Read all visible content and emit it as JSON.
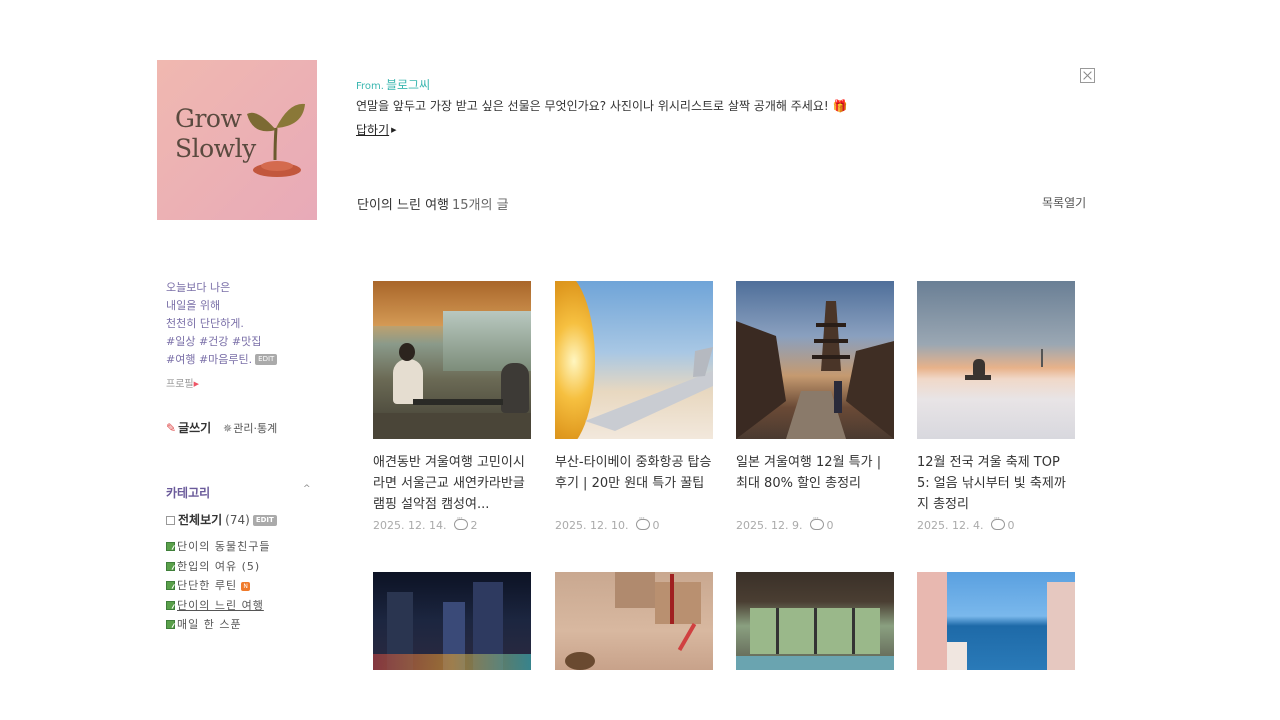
{
  "logo": {
    "line1": "Grow",
    "line2": "Slowly"
  },
  "notice": {
    "from_label": "From.",
    "from_name": "블로그씨",
    "message": "연말을 앞두고 가장 받고 싶은 선물은 무엇인가요? 사진이나 위시리스트로 살짝 공개해 주세요! 🎁",
    "reply_label": "답하기"
  },
  "category_header": {
    "name": "단이의 느린 여행",
    "count": "15개의 글",
    "list_toggle": "목록열기"
  },
  "sidebar": {
    "bio_lines": [
      "오늘보다 나은",
      "내일을 위해",
      "천천히 단단하게.",
      "#일상 #건강 #맛집",
      "#여행 #마음루틴."
    ],
    "edit_tag": "EDIT",
    "profile_link": "프로필",
    "write_label": "글쓰기",
    "admin_label": "관리·통계",
    "category_title": "카테고리",
    "all_label": "전체보기",
    "all_count": "(74)",
    "categories": [
      {
        "label": "단이의 동물친구들"
      },
      {
        "label": "한입의 여유 (5)"
      },
      {
        "label": "단단한 루틴",
        "badge": "N"
      },
      {
        "label": "단이의 느린 여행"
      },
      {
        "label": "매일 한 스푼"
      }
    ]
  },
  "posts": [
    {
      "title": "애견동반 겨울여행 고민이시라면 서울근교 새연카라반글램핑 설악점 캠성여...",
      "date": "2025. 12. 14.",
      "comments": "2"
    },
    {
      "title": "부산-타이베이 중화항공 탑승 후기 | 20만 원대 특가 꿀팁",
      "date": "2025. 12. 10.",
      "comments": "0"
    },
    {
      "title": "일본 겨울여행 12월 특가 | 최대 80% 할인 총정리",
      "date": "2025. 12. 9.",
      "comments": "0"
    },
    {
      "title": "12월 전국 겨울 축제 TOP 5: 얼음 낚시부터 빛 축제까지 총정리",
      "date": "2025. 12. 4.",
      "comments": "0"
    }
  ],
  "image_names": [
    "glamping-photo",
    "airplane-wing-photo",
    "kyoto-street-photo",
    "ice-fishing-photo",
    "city-night-photo",
    "christmas-gift-photo",
    "indoor-pool-photo",
    "santorini-photo"
  ]
}
